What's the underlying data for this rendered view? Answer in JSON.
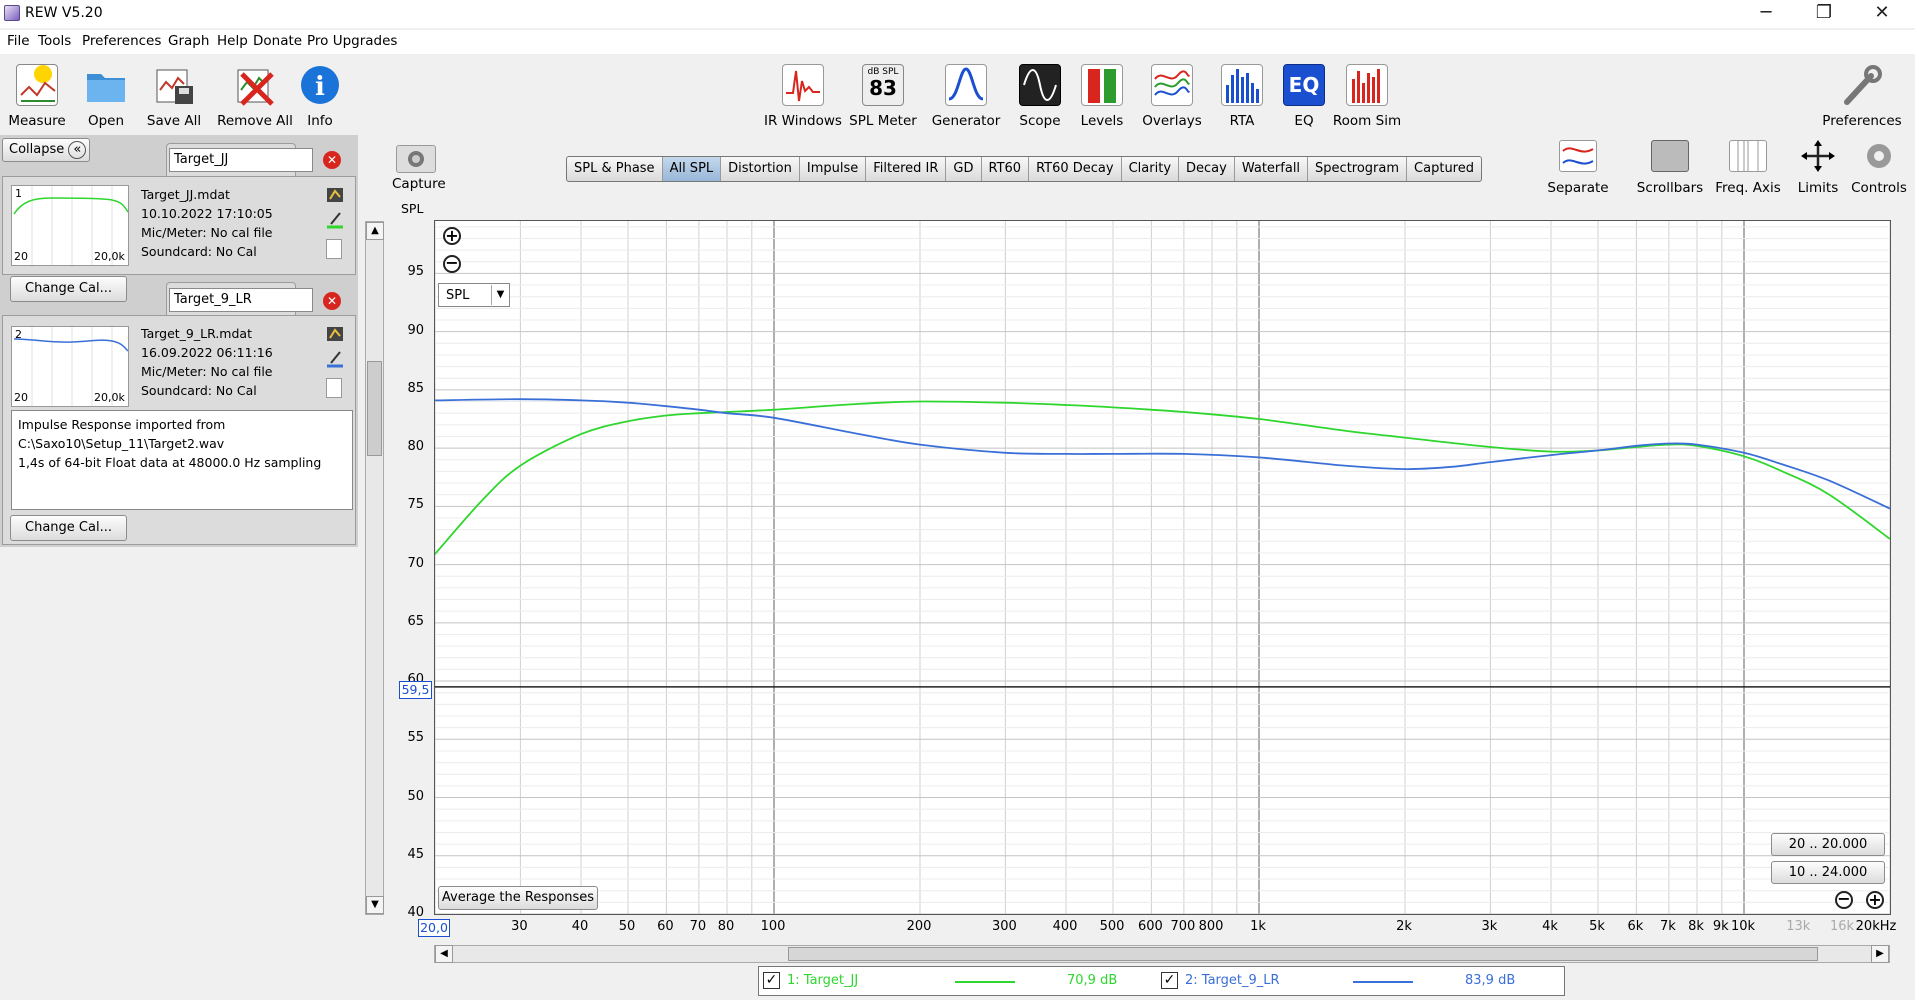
{
  "window": {
    "title": "REW V5.20",
    "minimize": "─",
    "restore": "❐",
    "close": "✕"
  },
  "menu": [
    "File",
    "Tools",
    "Preferences",
    "Graph",
    "Help",
    "Donate",
    "Pro Upgrades"
  ],
  "toolbar_left": [
    {
      "label": "Measure",
      "icon": "measure-icon"
    },
    {
      "label": "Open",
      "icon": "folder-icon"
    },
    {
      "label": "Save All",
      "icon": "save-icon"
    },
    {
      "label": "Remove All",
      "icon": "remove-icon"
    },
    {
      "label": "Info",
      "icon": "info-icon"
    }
  ],
  "toolbar_mid": [
    {
      "label": "IR Windows",
      "icon": "ir-windows-icon"
    },
    {
      "label": "SPL Meter",
      "icon": "spl-meter-icon",
      "badge_top": "dB SPL",
      "badge_value": "83"
    },
    {
      "label": "Generator",
      "icon": "generator-icon"
    },
    {
      "label": "Scope",
      "icon": "scope-icon"
    },
    {
      "label": "Levels",
      "icon": "levels-icon"
    },
    {
      "label": "Overlays",
      "icon": "overlays-icon"
    },
    {
      "label": "RTA",
      "icon": "rta-icon"
    },
    {
      "label": "EQ",
      "icon": "eq-icon",
      "text": "EQ"
    },
    {
      "label": "Room Sim",
      "icon": "room-sim-icon"
    }
  ],
  "toolbar_right": {
    "label": "Preferences",
    "icon": "wrench-icon"
  },
  "graph_tools": [
    {
      "label": "Separate"
    },
    {
      "label": "Scrollbars"
    },
    {
      "label": "Freq. Axis"
    },
    {
      "label": "Limits"
    },
    {
      "label": "Controls"
    }
  ],
  "capture": {
    "label": "Capture"
  },
  "collapse_label": "Collapse",
  "collapse_glyph": "«",
  "measurements": [
    {
      "index": "1",
      "name": "Target_JJ",
      "file": "Target_JJ.mdat",
      "date": "10.10.2022 17:10:05",
      "mic": "Mic/Meter: No cal file",
      "sound": "Soundcard: No Cal",
      "color": "#2ed62e",
      "thumb_min": "20",
      "thumb_max": "20,0k"
    },
    {
      "index": "2",
      "name": "Target_9_LR",
      "file": "Target_9_LR.mdat",
      "date": "16.09.2022 06:11:16",
      "mic": "Mic/Meter: No cal file",
      "sound": "Soundcard: No Cal",
      "color": "#3a6fd8",
      "thumb_min": "20",
      "thumb_max": "20,0k"
    }
  ],
  "notes": [
    "Impulse Response imported from",
    "C:\\Saxo10\\Setup_11\\Target2.wav",
    "1,4s of 64-bit Float data at 48000.0 Hz sampling"
  ],
  "change_cal": "Change Cal...",
  "tabs": [
    "SPL & Phase",
    "All SPL",
    "Distortion",
    "Impulse",
    "Filtered IR",
    "GD",
    "RT60",
    "RT60 Decay",
    "Clarity",
    "Decay",
    "Waterfall",
    "Spectrogram",
    "Captured"
  ],
  "active_tab": "All SPL",
  "graph": {
    "y_axis_title": "SPL",
    "select_value": "SPL",
    "cursor_value": "59,5",
    "x_start_value": "20,0",
    "average_button": "Average the Responses",
    "range_buttons": [
      "20 .. 20.000",
      "10 .. 24.000"
    ]
  },
  "legend": [
    {
      "label": "1: Target_JJ",
      "value": "70,9 dB",
      "color": "#2ed62e"
    },
    {
      "label": "2: Target_9_LR",
      "value": "83,9 dB",
      "color": "#3a6fd8"
    }
  ],
  "chart_data": {
    "type": "line",
    "xscale": "log",
    "xlim": [
      20,
      20000
    ],
    "ylim": [
      40,
      99.5
    ],
    "ylabel": "SPL",
    "y_ticks": [
      40,
      45,
      50,
      55,
      60,
      65,
      70,
      75,
      80,
      85,
      90,
      95
    ],
    "x_ticks": [
      {
        "v": 30,
        "t": "30"
      },
      {
        "v": 40,
        "t": "40"
      },
      {
        "v": 50,
        "t": "50"
      },
      {
        "v": 60,
        "t": "60"
      },
      {
        "v": 70,
        "t": "70"
      },
      {
        "v": 80,
        "t": "80"
      },
      {
        "v": 100,
        "t": "100"
      },
      {
        "v": 200,
        "t": "200"
      },
      {
        "v": 300,
        "t": "300"
      },
      {
        "v": 400,
        "t": "400"
      },
      {
        "v": 500,
        "t": "500"
      },
      {
        "v": 600,
        "t": "600"
      },
      {
        "v": 700,
        "t": "700"
      },
      {
        "v": 800,
        "t": "800"
      },
      {
        "v": 1000,
        "t": "1k"
      },
      {
        "v": 2000,
        "t": "2k"
      },
      {
        "v": 3000,
        "t": "3k"
      },
      {
        "v": 4000,
        "t": "4k"
      },
      {
        "v": 5000,
        "t": "5k"
      },
      {
        "v": 6000,
        "t": "6k"
      },
      {
        "v": 7000,
        "t": "7k"
      },
      {
        "v": 8000,
        "t": "8k"
      },
      {
        "v": 9000,
        "t": "9k"
      },
      {
        "v": 10000,
        "t": "10k"
      },
      {
        "v": 13000,
        "t": "13k"
      },
      {
        "v": 16000,
        "t": "16k"
      },
      {
        "v": 20000,
        "t": "20kHz"
      }
    ],
    "cursor_y": 59.5,
    "series": [
      {
        "name": "1: Target_JJ",
        "color": "#2ed62e",
        "x": [
          20,
          25,
          30,
          40,
          50,
          60,
          70,
          80,
          100,
          150,
          200,
          300,
          400,
          500,
          700,
          1000,
          1500,
          2000,
          3000,
          4000,
          5000,
          6000,
          7000,
          8000,
          10000,
          12000,
          15000,
          20000
        ],
        "y": [
          70.9,
          75.5,
          78.5,
          81.2,
          82.3,
          82.8,
          83.0,
          83.1,
          83.3,
          83.8,
          84.0,
          83.9,
          83.7,
          83.5,
          83.1,
          82.5,
          81.5,
          80.9,
          80.1,
          79.7,
          79.8,
          80.1,
          80.3,
          80.2,
          79.3,
          78.0,
          76.0,
          72.2
        ]
      },
      {
        "name": "2: Target_9_LR",
        "color": "#3a6fd8",
        "x": [
          20,
          30,
          40,
          50,
          60,
          70,
          80,
          100,
          150,
          200,
          300,
          400,
          500,
          700,
          1000,
          1500,
          2000,
          2500,
          3000,
          4000,
          5000,
          6000,
          7000,
          8000,
          10000,
          12000,
          15000,
          20000
        ],
        "y": [
          84.1,
          84.2,
          84.1,
          83.9,
          83.6,
          83.3,
          83.0,
          82.6,
          81.2,
          80.3,
          79.6,
          79.5,
          79.5,
          79.5,
          79.2,
          78.5,
          78.2,
          78.4,
          78.8,
          79.4,
          79.8,
          80.2,
          80.4,
          80.3,
          79.6,
          78.6,
          77.2,
          74.8
        ]
      }
    ]
  }
}
